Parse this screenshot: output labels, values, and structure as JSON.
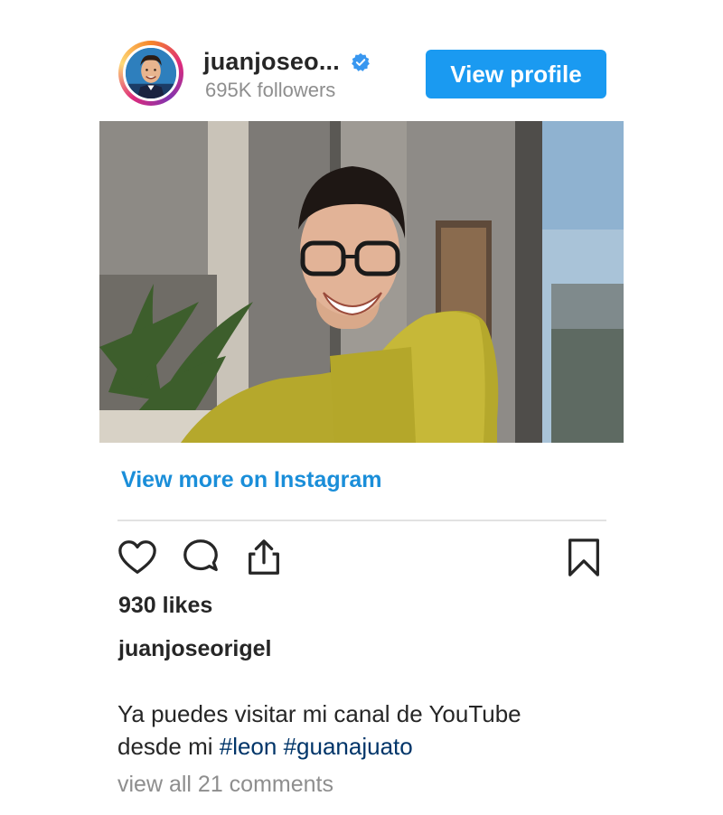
{
  "header": {
    "username": "juanjoseo...",
    "followers": "695K followers",
    "view_profile_label": "View profile"
  },
  "post": {
    "view_more_label": "View more on Instagram",
    "likes": "930 likes",
    "author": "juanjoseorigel",
    "caption_line1": "Ya puedes visitar mi canal de YouTube",
    "caption_line2_prefix": "desde mi ",
    "hashtags": [
      "#leon",
      "#guanajuato"
    ],
    "comments_label": "view all 21 comments"
  },
  "icons": {
    "like": "heart-icon",
    "comment": "comment-icon",
    "share": "share-icon",
    "save": "bookmark-icon",
    "verified": "verified-badge-icon"
  },
  "colors": {
    "button_blue": "#1a9af1",
    "link_blue": "#1a8ed9",
    "hashtag_blue": "#003569",
    "muted_gray": "#8e8e8e",
    "text_dark": "#262626"
  }
}
